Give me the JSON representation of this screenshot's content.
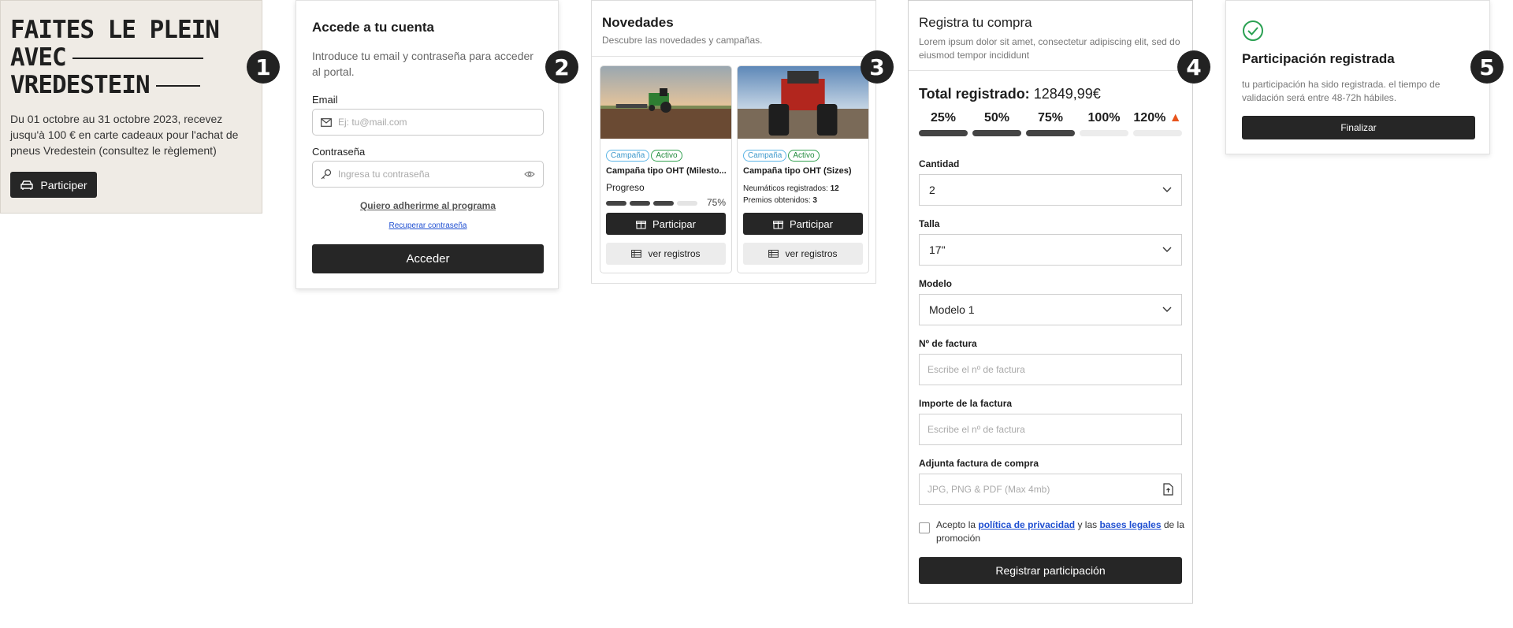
{
  "steps": [
    "1",
    "2",
    "3",
    "4",
    "5"
  ],
  "panel1": {
    "headline": [
      "FAITES LE PLEIN",
      "AVEC",
      "VREDESTEIN"
    ],
    "description": "Du 01 octobre au 31 octobre 2023, recevez jusqu'à 100 € en carte cadeaux pour l'achat de pneus Vredestein (consultez le règlement)",
    "button_label": "Participer",
    "button_icon": "car-icon"
  },
  "panel2": {
    "title": "Accede a tu cuenta",
    "subtitle": "Introduce tu email y contraseña para acceder al portal.",
    "email_label": "Email",
    "email_placeholder": "Ej: tu@mail.com",
    "password_label": "Contraseña",
    "password_placeholder": "Ingresa tu contraseña",
    "join_link": "Quiero adherirme al programa",
    "recover_link": "Recuperar contraseña",
    "submit_label": "Acceder"
  },
  "panel3": {
    "title": "Novedades",
    "subtitle": "Descubre las novedades y campañas.",
    "cards": [
      {
        "tags": [
          "Campaña",
          "Activo"
        ],
        "title": "Campaña tipo OHT (Milesto...",
        "progress_label": "Progreso",
        "progress_value": 0.75,
        "progress_text": "75%",
        "participate_label": "Participar",
        "records_label": "ver registros"
      },
      {
        "tags": [
          "Campaña",
          "Activo"
        ],
        "title": "Campaña tipo OHT (Sizes)",
        "tires_label": "Neumáticos registrados:",
        "tires_value": "12",
        "prizes_label": "Premios obtenidos:",
        "prizes_value": "3",
        "participate_label": "Participar",
        "records_label": "ver registros"
      }
    ]
  },
  "panel4": {
    "title": "Registra tu compra",
    "subtitle": "Lorem ipsum dolor sit amet, consectetur adipiscing elit, sed do eiusmod tempor incididunt",
    "total_label": "Total registrado:",
    "total_value": "12849,99€",
    "milestones": [
      {
        "label": "25%",
        "reached": true
      },
      {
        "label": "50%",
        "reached": true
      },
      {
        "label": "75%",
        "reached": true
      },
      {
        "label": "100%",
        "reached": false
      },
      {
        "label": "120%",
        "reached": false
      }
    ],
    "quantity_label": "Cantidad",
    "quantity_value": "2",
    "size_label": "Talla",
    "size_value": "17\"",
    "model_label": "Modelo",
    "model_value": "Modelo 1",
    "invoice_no_label": "Nº de factura",
    "invoice_no_placeholder": "Escribe el nº de factura",
    "invoice_amount_label": "Importe de la factura",
    "invoice_amount_placeholder": "Escribe el nº de factura",
    "attach_label": "Adjunta factura de compra",
    "attach_placeholder": "JPG, PNG & PDF (Max 4mb)",
    "legal_prefix": "Acepto la",
    "privacy_link": "política de privacidad",
    "legal_middle": "y las",
    "terms_link": "bases legales",
    "legal_suffix": "de la promoción",
    "submit_label": "Registrar participación"
  },
  "panel5": {
    "title": "Participación registrada",
    "subtitle": "tu participación ha sido registrada. el tiempo de validación será entre 48-72h hábiles.",
    "button_label": "Finalizar"
  },
  "colors": {
    "dark": "#262626",
    "beige": "#efebe5",
    "success": "#2aa052",
    "link": "#1f4fd1"
  }
}
